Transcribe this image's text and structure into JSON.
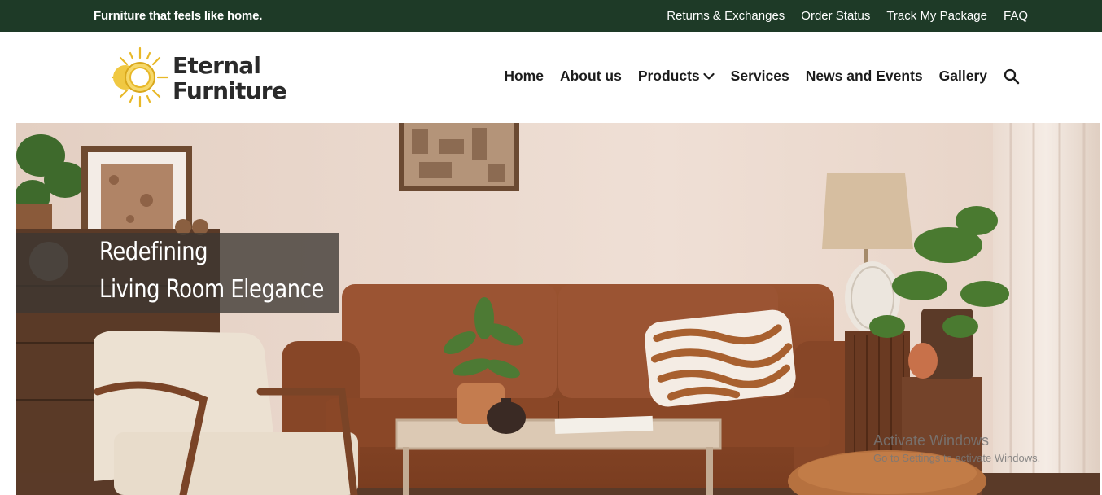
{
  "topbar": {
    "tagline": "Furniture that feels like home.",
    "links": [
      "Returns & Exchanges",
      "Order Status",
      "Track My Package",
      "FAQ"
    ]
  },
  "header": {
    "logo": {
      "line1": "Eternal",
      "line2": "Furniture",
      "icon": "sun-icon"
    },
    "nav": {
      "home": "Home",
      "about": "About us",
      "products": "Products",
      "services": "Services",
      "news": "News and Events",
      "gallery": "Gallery"
    },
    "icons": {
      "dropdown": "chevron-down-icon",
      "search": "search-icon"
    }
  },
  "hero": {
    "line1": "Redefining",
    "line2": "Living Room Elegance"
  },
  "watermark": {
    "title": "Activate Windows",
    "subtitle": "Go to Settings to activate Windows."
  },
  "colors": {
    "topbar_bg": "#1e3a27",
    "accent_gold": "#e8b828",
    "sofa": "#8f4a2a",
    "wall": "#ead8cd"
  }
}
